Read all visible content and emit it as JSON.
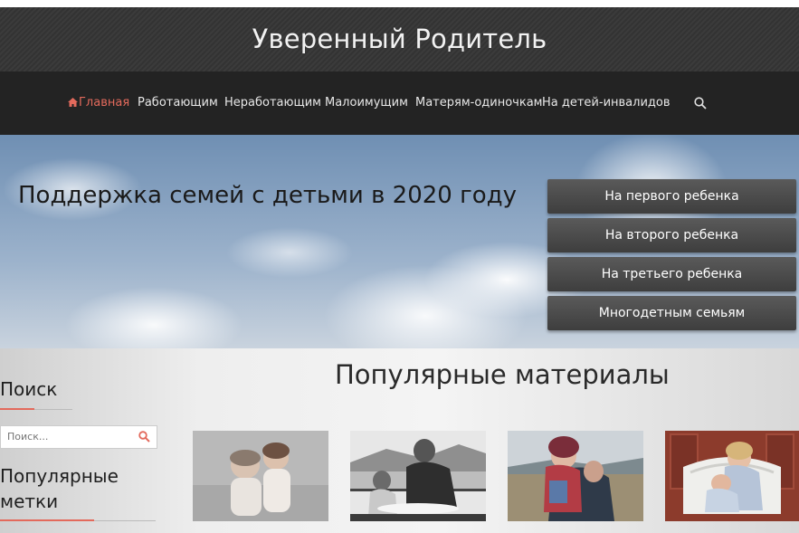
{
  "header": {
    "site_title": "Уверенный Родитель"
  },
  "nav": {
    "items": [
      "Главная",
      "Работающим",
      "Неработающим",
      "Малоимущим",
      "Матерям-одиночкам",
      "На детей-инвалидов"
    ],
    "active_index": 0
  },
  "hero": {
    "title": "Поддержка семей с детьми в 2020 году",
    "buttons": [
      "На первого ребенка",
      "На второго ребенка",
      "На третьего ребенка",
      "Многодетным семьям"
    ]
  },
  "sidebar": {
    "search_heading": "Поиск",
    "search_placeholder": "Поиск...",
    "tags_heading_line1": "Популярные",
    "tags_heading_line2": "метки"
  },
  "main": {
    "popular_title": "Популярные материалы"
  },
  "colors": {
    "accent": "#e36a5c",
    "nav_bg": "#232323",
    "header_bg": "#363636"
  },
  "icons": [
    "home-icon",
    "search-icon"
  ]
}
